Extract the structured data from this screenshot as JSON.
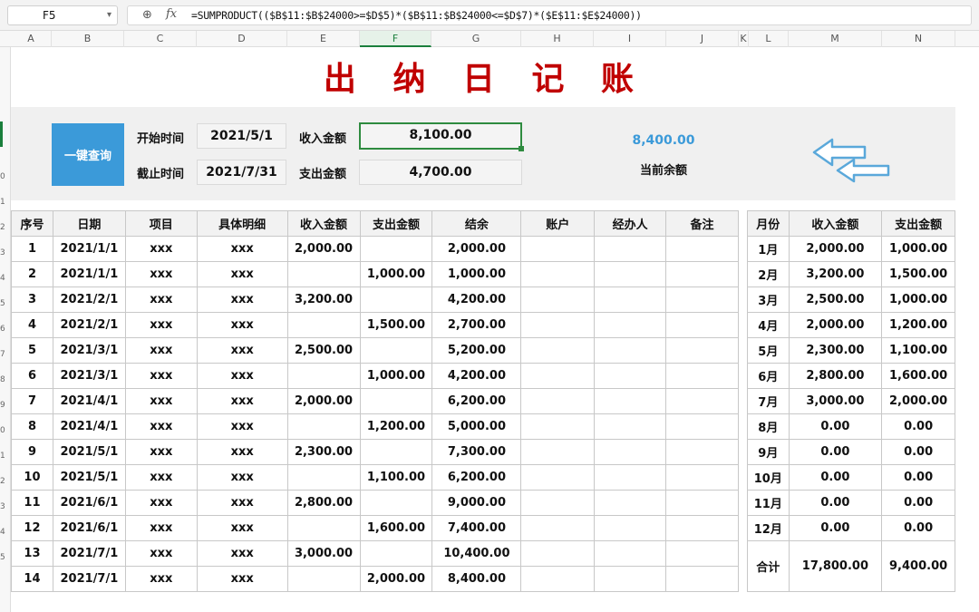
{
  "formula_bar": {
    "cell_ref": "F5",
    "formula": "=SUMPRODUCT(($B$11:$B$24000>=$D$5)*($B$11:$B$24000<=$D$7)*($E$11:$E$24000))",
    "zoom_icon": "magnifier-icon",
    "fx_label": "fx"
  },
  "columns": [
    "A",
    "B",
    "C",
    "D",
    "E",
    "F",
    "G",
    "H",
    "I",
    "J",
    "K",
    "L",
    "M",
    "N"
  ],
  "row_numbers": [
    "0",
    "1",
    "2",
    "3",
    "4",
    "5",
    "6",
    "7",
    "8",
    "9",
    "0",
    "1",
    "2",
    "3",
    "4",
    "5"
  ],
  "title": "出 纳 日 记 账",
  "query": {
    "button": "一键查询",
    "start_label": "开始时间",
    "start_value": "2021/5/1",
    "end_label": "截止时间",
    "end_value": "2021/7/31",
    "income_label": "收入金额",
    "income_value": "8,100.00",
    "expense_label": "支出金额",
    "expense_value": "4,700.00",
    "balance_value": "8,400.00",
    "balance_label": "当前余额",
    "arrows_icon": "double-left-arrow-icon"
  },
  "ledger": {
    "headers": [
      "序号",
      "日期",
      "项目",
      "具体明细",
      "收入金额",
      "支出金额",
      "结余",
      "账户",
      "经办人",
      "备注"
    ],
    "rows": [
      [
        "1",
        "2021/1/1",
        "xxx",
        "xxx",
        "2,000.00",
        "",
        "2,000.00",
        "",
        "",
        ""
      ],
      [
        "2",
        "2021/1/1",
        "xxx",
        "xxx",
        "",
        "1,000.00",
        "1,000.00",
        "",
        "",
        ""
      ],
      [
        "3",
        "2021/2/1",
        "xxx",
        "xxx",
        "3,200.00",
        "",
        "4,200.00",
        "",
        "",
        ""
      ],
      [
        "4",
        "2021/2/1",
        "xxx",
        "xxx",
        "",
        "1,500.00",
        "2,700.00",
        "",
        "",
        ""
      ],
      [
        "5",
        "2021/3/1",
        "xxx",
        "xxx",
        "2,500.00",
        "",
        "5,200.00",
        "",
        "",
        ""
      ],
      [
        "6",
        "2021/3/1",
        "xxx",
        "xxx",
        "",
        "1,000.00",
        "4,200.00",
        "",
        "",
        ""
      ],
      [
        "7",
        "2021/4/1",
        "xxx",
        "xxx",
        "2,000.00",
        "",
        "6,200.00",
        "",
        "",
        ""
      ],
      [
        "8",
        "2021/4/1",
        "xxx",
        "xxx",
        "",
        "1,200.00",
        "5,000.00",
        "",
        "",
        ""
      ],
      [
        "9",
        "2021/5/1",
        "xxx",
        "xxx",
        "2,300.00",
        "",
        "7,300.00",
        "",
        "",
        ""
      ],
      [
        "10",
        "2021/5/1",
        "xxx",
        "xxx",
        "",
        "1,100.00",
        "6,200.00",
        "",
        "",
        ""
      ],
      [
        "11",
        "2021/6/1",
        "xxx",
        "xxx",
        "2,800.00",
        "",
        "9,000.00",
        "",
        "",
        ""
      ],
      [
        "12",
        "2021/6/1",
        "xxx",
        "xxx",
        "",
        "1,600.00",
        "7,400.00",
        "",
        "",
        ""
      ],
      [
        "13",
        "2021/7/1",
        "xxx",
        "xxx",
        "3,000.00",
        "",
        "10,400.00",
        "",
        "",
        ""
      ],
      [
        "14",
        "2021/7/1",
        "xxx",
        "xxx",
        "",
        "2,000.00",
        "8,400.00",
        "",
        "",
        ""
      ]
    ]
  },
  "monthly": {
    "headers": [
      "月份",
      "收入金额",
      "支出金额"
    ],
    "rows": [
      [
        "1月",
        "2,000.00",
        "1,000.00"
      ],
      [
        "2月",
        "3,200.00",
        "1,500.00"
      ],
      [
        "3月",
        "2,500.00",
        "1,000.00"
      ],
      [
        "4月",
        "2,000.00",
        "1,200.00"
      ],
      [
        "5月",
        "2,300.00",
        "1,100.00"
      ],
      [
        "6月",
        "2,800.00",
        "1,600.00"
      ],
      [
        "7月",
        "3,000.00",
        "2,000.00"
      ],
      [
        "8月",
        "0.00",
        "0.00"
      ],
      [
        "9月",
        "0.00",
        "0.00"
      ],
      [
        "10月",
        "0.00",
        "0.00"
      ],
      [
        "11月",
        "0.00",
        "0.00"
      ],
      [
        "12月",
        "0.00",
        "0.00"
      ]
    ],
    "total": [
      "合计",
      "17,800.00",
      "9,400.00"
    ]
  }
}
